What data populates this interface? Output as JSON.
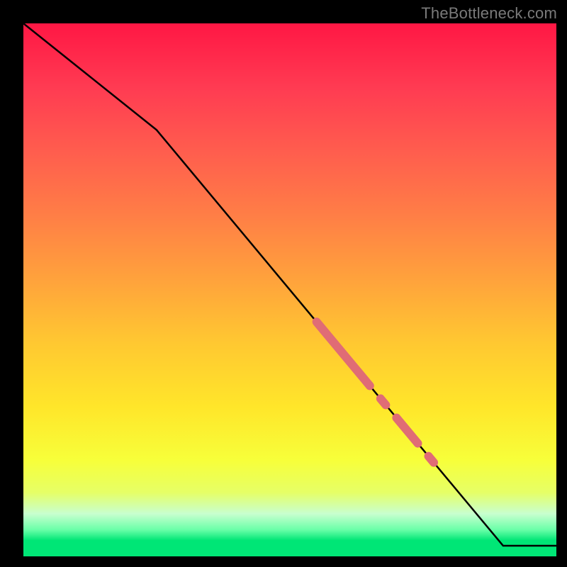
{
  "watermark": "TheBottleneck.com",
  "colors": {
    "line": "#000000",
    "accent": "#e06c75"
  },
  "chart_data": {
    "type": "line",
    "title": "",
    "xlabel": "",
    "ylabel": "",
    "xlim": [
      0,
      100
    ],
    "ylim": [
      0,
      100
    ],
    "grid": false,
    "legend": false,
    "x": [
      0,
      25,
      90,
      100
    ],
    "values": [
      100,
      80,
      2,
      2
    ],
    "accent_segments": [
      {
        "x_start": 55,
        "x_end": 65
      },
      {
        "x_start": 67,
        "x_end": 68
      },
      {
        "x_start": 70,
        "x_end": 74
      },
      {
        "x_start": 76,
        "x_end": 77
      }
    ],
    "accent_thickness": 12
  }
}
